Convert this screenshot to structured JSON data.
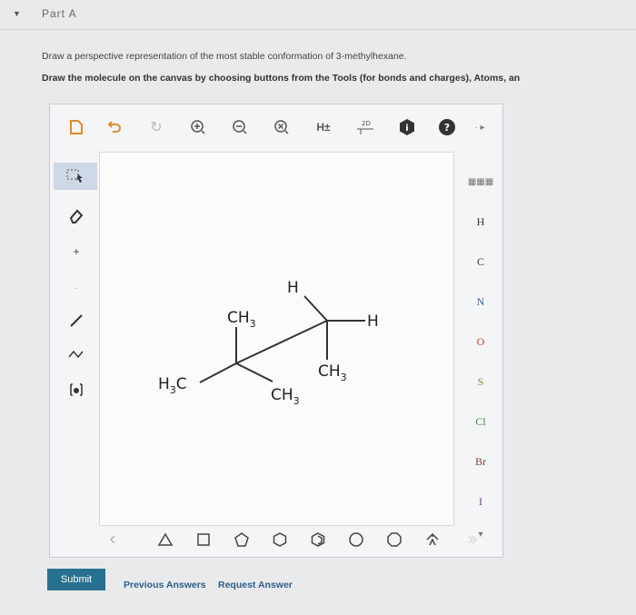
{
  "part": {
    "title": "Part A"
  },
  "question": {
    "line1": "Draw a perspective representation of the most stable conformation of 3-methylhexane.",
    "line2": "Draw the molecule on the canvas by choosing buttons from the Tools (for bonds and charges), Atoms, an"
  },
  "toolbar": {
    "h_toggle_label": "H±",
    "two_d_label": "2D",
    "info_label": "i",
    "help_label": "?"
  },
  "atoms": [
    "H",
    "C",
    "N",
    "O",
    "S",
    "Cl",
    "Br",
    "I"
  ],
  "molecule": {
    "labels": {
      "h_top": "H",
      "h_right": "H",
      "ch3_top": "CH",
      "ch3_right": "CH",
      "ch3_bottom": "CH",
      "h3c_left": "H",
      "h3c_left_c": "C",
      "sub3": "3"
    }
  },
  "footer": {
    "submit_label": "Submit",
    "previous_answers_label": "Previous Answers",
    "request_answer_label": "Request Answer"
  },
  "colors": {
    "submit": "#28708f",
    "link": "#2a5e8c",
    "selected_tool": "#cfd8e6"
  }
}
